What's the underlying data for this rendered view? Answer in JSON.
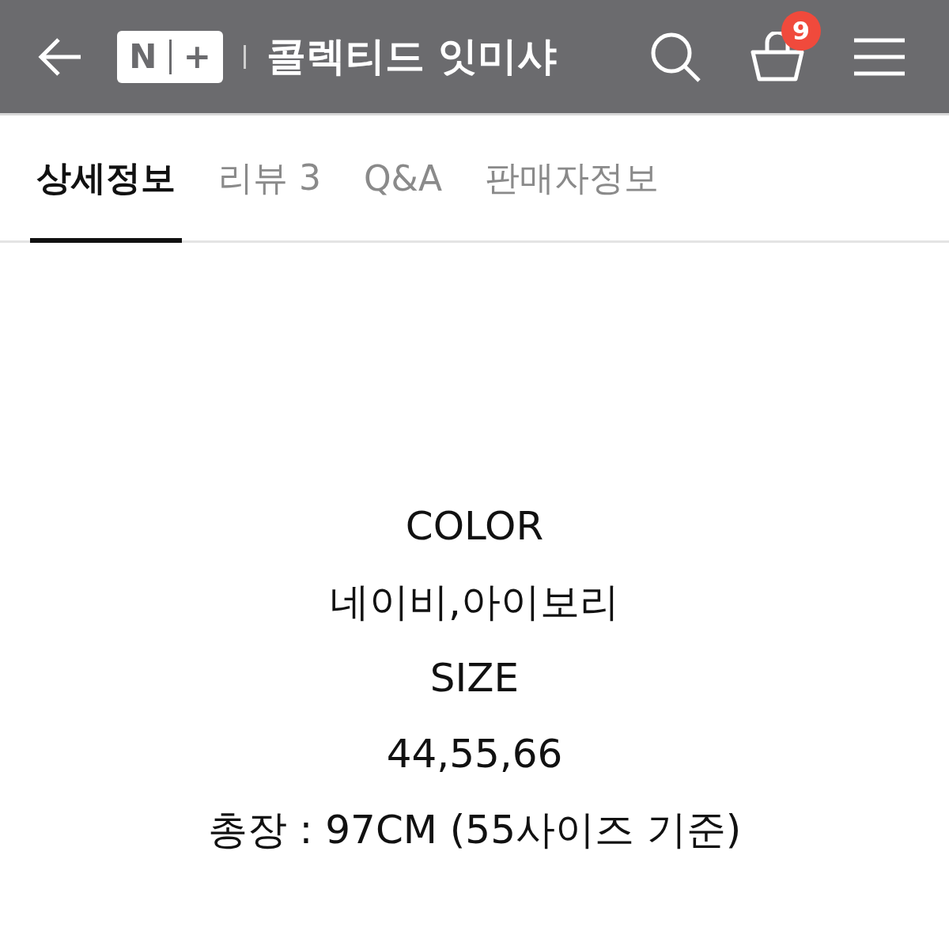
{
  "header": {
    "logo": {
      "left": "N",
      "right": "+"
    },
    "title": "콜렉티드 잇미샤",
    "cart_count": "9"
  },
  "tabs": [
    {
      "label": "상세정보",
      "selected": true
    },
    {
      "label": "리뷰 3",
      "selected": false
    },
    {
      "label": "Q&A",
      "selected": false
    },
    {
      "label": "판매자정보",
      "selected": false
    }
  ],
  "details": [
    "COLOR",
    "네이비,아이보리",
    "SIZE",
    "44,55,66",
    "총장 : 97CM (55사이즈 기준)"
  ]
}
